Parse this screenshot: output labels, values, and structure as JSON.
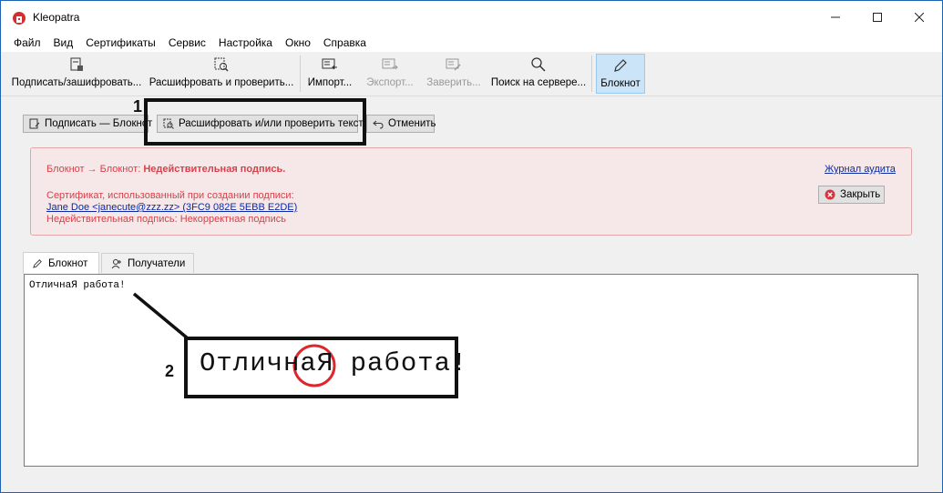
{
  "window": {
    "title": "Kleopatra"
  },
  "menu": [
    "Файл",
    "Вид",
    "Сертификаты",
    "Сервис",
    "Настройка",
    "Окно",
    "Справка"
  ],
  "toolbar": {
    "sign_encrypt": "Подписать/зашифровать...",
    "decrypt_verify": "Расшифровать и проверить...",
    "import": "Импорт...",
    "export": "Экспорт...",
    "certify": "Заверить...",
    "search_server": "Поиск на сервере...",
    "notepad": "Блокнот"
  },
  "actions": {
    "sign_notepad": "Подписать — Блокнот",
    "decrypt_verify_text": "Расшифровать и/или проверить текст",
    "cancel": "Отменить"
  },
  "alert": {
    "prefix": "Блокнот → Блокнот: ",
    "headline": "Недействительная подпись.",
    "audit_link": "Журнал аудита",
    "cert_line": "Сертификат, использованный при создании подписи:",
    "cert_link": "Jane Doe <janecute@zzz.zz> (3FC9 082E 5EBB E2DE)",
    "reason": "Недействительная подпись: Некорректная подпись",
    "close": "Закрыть"
  },
  "tabs": {
    "notepad": "Блокнот",
    "recipients": "Получатели"
  },
  "editor": {
    "content": "ОтличнаЯ работа!"
  },
  "annotations": {
    "label_1": "1",
    "label_2": "2",
    "zoom_before": "Отлична",
    "zoom_highlight": "Я",
    "zoom_after": " работа!"
  },
  "colors": {
    "error_text": "#d7414a",
    "link": "#0b2aa4",
    "alert_bg": "#f6e8e8",
    "highlight_circle": "#e0262d"
  }
}
